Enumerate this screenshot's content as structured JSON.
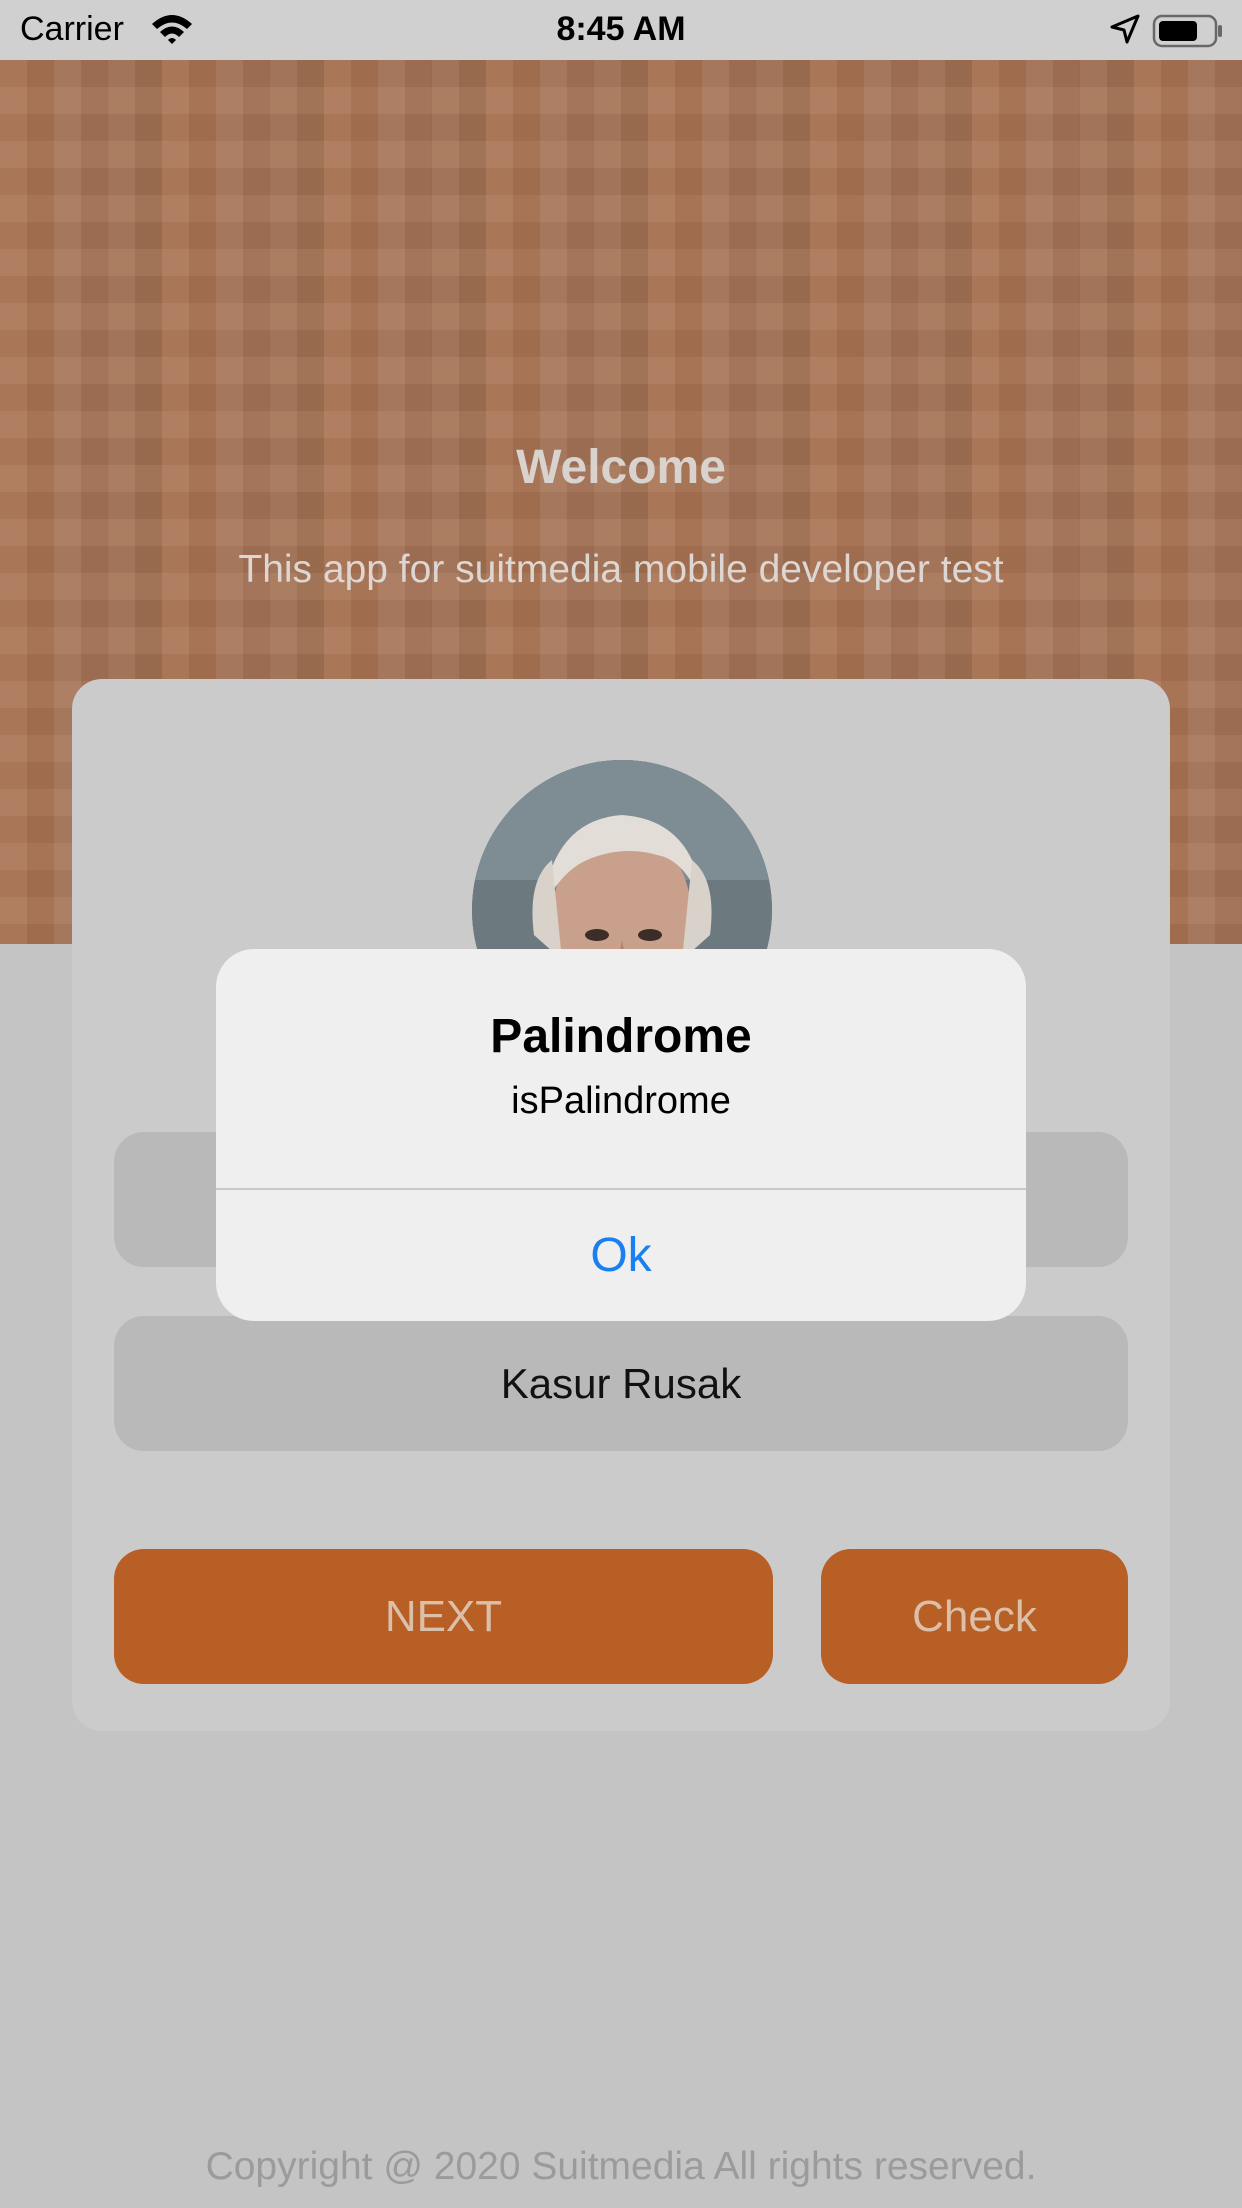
{
  "status_bar": {
    "carrier": "Carrier",
    "time": "8:45 AM"
  },
  "header": {
    "title": "Welcome",
    "subtitle": "This app for suitmedia mobile developer test"
  },
  "form": {
    "second_field_value": "Kasur Rusak",
    "next_label": "NEXT",
    "check_label": "Check"
  },
  "footer": {
    "copyright": "Copyright @ 2020 Suitmedia All rights reserved."
  },
  "alert": {
    "title": "Palindrome",
    "message": "isPalindrome",
    "ok_label": "Ok"
  },
  "colors": {
    "accent": "#b75f24",
    "alert_button": "#1a7ff0",
    "header_background": "#a57457"
  }
}
